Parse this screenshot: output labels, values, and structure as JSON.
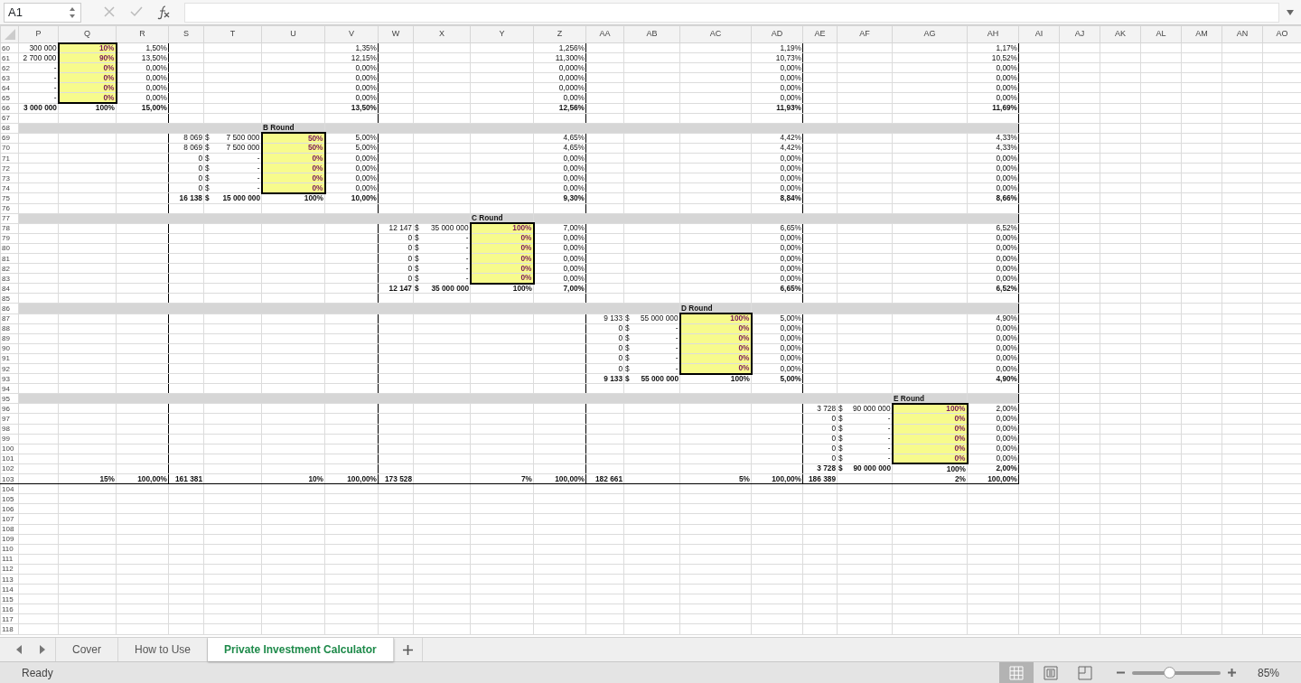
{
  "formula_bar": {
    "cell_ref": "A1"
  },
  "columns": [
    {
      "label": "P"
    },
    {
      "label": "Q"
    },
    {
      "label": "R"
    },
    {
      "label": "S"
    },
    {
      "label": "T"
    },
    {
      "label": "U"
    },
    {
      "label": "V"
    },
    {
      "label": "W"
    },
    {
      "label": "X"
    },
    {
      "label": "Y"
    },
    {
      "label": "Z"
    },
    {
      "label": "AA"
    },
    {
      "label": "AB"
    },
    {
      "label": "AC"
    },
    {
      "label": "AD"
    },
    {
      "label": "AE"
    },
    {
      "label": "AF"
    },
    {
      "label": "AG"
    },
    {
      "label": "AH"
    },
    {
      "label": "AI"
    },
    {
      "label": "AJ"
    },
    {
      "label": "AK"
    },
    {
      "label": "AL"
    },
    {
      "label": "AM"
    },
    {
      "label": "AN"
    },
    {
      "label": "AO"
    }
  ],
  "rows": [
    {
      "number": "60",
      "kind": "data",
      "cells": [
        {
          "text": "300 000"
        },
        {
          "text": "10%",
          "kind": "input"
        },
        {
          "text": "1,50%"
        },
        {},
        {},
        {},
        {
          "text": "1,35%"
        },
        {},
        {},
        {},
        {
          "text": "1,256%"
        },
        {},
        {},
        {},
        {
          "text": "1,19%"
        },
        {},
        {},
        {},
        {
          "text": "1,17%"
        }
      ]
    },
    {
      "number": "61",
      "kind": "data",
      "cells": [
        {
          "text": "2 700 000"
        },
        {
          "text": "90%",
          "kind": "input"
        },
        {
          "text": "13,50%"
        },
        {},
        {},
        {},
        {
          "text": "12,15%"
        },
        {},
        {},
        {},
        {
          "text": "11,300%"
        },
        {},
        {},
        {},
        {
          "text": "10,73%"
        },
        {},
        {},
        {},
        {
          "text": "10,52%"
        }
      ]
    },
    {
      "number": "62",
      "kind": "data",
      "cells": [
        {
          "text": "-"
        },
        {
          "text": "0%",
          "kind": "input"
        },
        {
          "text": "0,00%"
        },
        {},
        {},
        {},
        {
          "text": "0,00%"
        },
        {},
        {},
        {},
        {
          "text": "0,000%"
        },
        {},
        {},
        {},
        {
          "text": "0,00%"
        },
        {},
        {},
        {},
        {
          "text": "0,00%"
        }
      ]
    },
    {
      "number": "63",
      "kind": "data",
      "cells": [
        {
          "text": "-"
        },
        {
          "text": "0%",
          "kind": "input"
        },
        {
          "text": "0,00%"
        },
        {},
        {},
        {},
        {
          "text": "0,00%"
        },
        {},
        {},
        {},
        {
          "text": "0,000%"
        },
        {},
        {},
        {},
        {
          "text": "0,00%"
        },
        {},
        {},
        {},
        {
          "text": "0,00%"
        }
      ]
    },
    {
      "number": "64",
      "kind": "data",
      "cells": [
        {
          "text": "-"
        },
        {
          "text": "0%",
          "kind": "input"
        },
        {
          "text": "0,00%"
        },
        {},
        {},
        {},
        {
          "text": "0,00%"
        },
        {},
        {},
        {},
        {
          "text": "0,000%"
        },
        {},
        {},
        {},
        {
          "text": "0,00%"
        },
        {},
        {},
        {},
        {
          "text": "0,00%"
        }
      ]
    },
    {
      "number": "65",
      "kind": "data",
      "cells": [
        {
          "text": "-"
        },
        {
          "text": "0%",
          "kind": "input"
        },
        {
          "text": "0,00%"
        },
        {},
        {},
        {},
        {
          "text": "0,00%"
        },
        {},
        {},
        {},
        {
          "text": "0,00%"
        },
        {},
        {},
        {},
        {
          "text": "0,00%"
        },
        {},
        {},
        {},
        {
          "text": "0,00%"
        }
      ]
    },
    {
      "number": "66",
      "kind": "total",
      "cells": [
        {
          "text": "3 000 000"
        },
        {
          "text": "100%"
        },
        {
          "text": "15,00%"
        },
        {},
        {},
        {},
        {
          "text": "13,50%"
        },
        {},
        {},
        {},
        {
          "text": "12,56%"
        },
        {},
        {},
        {},
        {
          "text": "11,93%"
        },
        {},
        {},
        {},
        {
          "text": "11,69%"
        }
      ]
    },
    {
      "number": "67",
      "kind": "data",
      "cells": []
    },
    {
      "number": "68",
      "kind": "band",
      "cells": [
        {},
        {},
        {},
        {},
        {},
        {
          "text": "B Round"
        }
      ]
    },
    {
      "number": "69",
      "kind": "data",
      "cells": [
        {},
        {},
        {},
        {
          "text": "8 069"
        },
        {
          "currency": "$",
          "text": "7 500 000"
        },
        {
          "text": "50%",
          "kind": "input"
        },
        {
          "text": "5,00%"
        },
        {},
        {},
        {},
        {
          "text": "4,65%"
        },
        {},
        {},
        {},
        {
          "text": "4,42%"
        },
        {},
        {},
        {},
        {
          "text": "4,33%"
        }
      ]
    },
    {
      "number": "70",
      "kind": "data",
      "cells": [
        {},
        {},
        {},
        {
          "text": "8 069"
        },
        {
          "currency": "$",
          "text": "7 500 000"
        },
        {
          "text": "50%",
          "kind": "input"
        },
        {
          "text": "5,00%"
        },
        {},
        {},
        {},
        {
          "text": "4,65%"
        },
        {},
        {},
        {},
        {
          "text": "4,42%"
        },
        {},
        {},
        {},
        {
          "text": "4,33%"
        }
      ]
    },
    {
      "number": "71",
      "kind": "data",
      "cells": [
        {},
        {},
        {},
        {
          "text": "0"
        },
        {
          "currency": "$",
          "text": "-"
        },
        {
          "text": "0%",
          "kind": "input"
        },
        {
          "text": "0,00%"
        },
        {},
        {},
        {},
        {
          "text": "0,00%"
        },
        {},
        {},
        {},
        {
          "text": "0,00%"
        },
        {},
        {},
        {},
        {
          "text": "0,00%"
        }
      ]
    },
    {
      "number": "72",
      "kind": "data",
      "cells": [
        {},
        {},
        {},
        {
          "text": "0"
        },
        {
          "currency": "$",
          "text": "-"
        },
        {
          "text": "0%",
          "kind": "input"
        },
        {
          "text": "0,00%"
        },
        {},
        {},
        {},
        {
          "text": "0,00%"
        },
        {},
        {},
        {},
        {
          "text": "0,00%"
        },
        {},
        {},
        {},
        {
          "text": "0,00%"
        }
      ]
    },
    {
      "number": "73",
      "kind": "data",
      "cells": [
        {},
        {},
        {},
        {
          "text": "0"
        },
        {
          "currency": "$",
          "text": "-"
        },
        {
          "text": "0%",
          "kind": "input"
        },
        {
          "text": "0,00%"
        },
        {},
        {},
        {},
        {
          "text": "0,00%"
        },
        {},
        {},
        {},
        {
          "text": "0,00%"
        },
        {},
        {},
        {},
        {
          "text": "0,00%"
        }
      ]
    },
    {
      "number": "74",
      "kind": "data",
      "cells": [
        {},
        {},
        {},
        {
          "text": "0"
        },
        {
          "currency": "$",
          "text": "-"
        },
        {
          "text": "0%",
          "kind": "input"
        },
        {
          "text": "0,00%"
        },
        {},
        {},
        {},
        {
          "text": "0,00%"
        },
        {},
        {},
        {},
        {
          "text": "0,00%"
        },
        {},
        {},
        {},
        {
          "text": "0,00%"
        }
      ]
    },
    {
      "number": "75",
      "kind": "total",
      "cells": [
        {},
        {},
        {},
        {
          "text": "16 138"
        },
        {
          "currency": "$",
          "text": "15 000 000"
        },
        {
          "text": "100%"
        },
        {
          "text": "10,00%"
        },
        {},
        {},
        {},
        {
          "text": "9,30%"
        },
        {},
        {},
        {},
        {
          "text": "8,84%"
        },
        {},
        {},
        {},
        {
          "text": "8,66%"
        }
      ]
    },
    {
      "number": "76",
      "kind": "data",
      "cells": []
    },
    {
      "number": "77",
      "kind": "band",
      "cells": [
        {},
        {},
        {},
        {},
        {},
        {},
        {},
        {},
        {},
        {
          "text": "C Round"
        }
      ]
    },
    {
      "number": "78",
      "kind": "data",
      "cells": [
        {},
        {},
        {},
        {},
        {},
        {},
        {},
        {
          "text": "12 147"
        },
        {
          "currency": "$",
          "text": "35 000 000"
        },
        {
          "text": "100%",
          "kind": "input"
        },
        {
          "text": "7,00%"
        },
        {},
        {},
        {},
        {
          "text": "6,65%"
        },
        {},
        {},
        {},
        {
          "text": "6,52%"
        }
      ]
    },
    {
      "number": "79",
      "kind": "data",
      "cells": [
        {},
        {},
        {},
        {},
        {},
        {},
        {},
        {
          "text": "0"
        },
        {
          "currency": "$",
          "text": "-"
        },
        {
          "text": "0%",
          "kind": "input"
        },
        {
          "text": "0,00%"
        },
        {},
        {},
        {},
        {
          "text": "0,00%"
        },
        {},
        {},
        {},
        {
          "text": "0,00%"
        }
      ]
    },
    {
      "number": "80",
      "kind": "data",
      "cells": [
        {},
        {},
        {},
        {},
        {},
        {},
        {},
        {
          "text": "0"
        },
        {
          "currency": "$",
          "text": "-"
        },
        {
          "text": "0%",
          "kind": "input"
        },
        {
          "text": "0,00%"
        },
        {},
        {},
        {},
        {
          "text": "0,00%"
        },
        {},
        {},
        {},
        {
          "text": "0,00%"
        }
      ]
    },
    {
      "number": "81",
      "kind": "data",
      "cells": [
        {},
        {},
        {},
        {},
        {},
        {},
        {},
        {
          "text": "0"
        },
        {
          "currency": "$",
          "text": "-"
        },
        {
          "text": "0%",
          "kind": "input"
        },
        {
          "text": "0,00%"
        },
        {},
        {},
        {},
        {
          "text": "0,00%"
        },
        {},
        {},
        {},
        {
          "text": "0,00%"
        }
      ]
    },
    {
      "number": "82",
      "kind": "data",
      "cells": [
        {},
        {},
        {},
        {},
        {},
        {},
        {},
        {
          "text": "0"
        },
        {
          "currency": "$",
          "text": "-"
        },
        {
          "text": "0%",
          "kind": "input"
        },
        {
          "text": "0,00%"
        },
        {},
        {},
        {},
        {
          "text": "0,00%"
        },
        {},
        {},
        {},
        {
          "text": "0,00%"
        }
      ]
    },
    {
      "number": "83",
      "kind": "data",
      "cells": [
        {},
        {},
        {},
        {},
        {},
        {},
        {},
        {
          "text": "0"
        },
        {
          "currency": "$",
          "text": "-"
        },
        {
          "text": "0%",
          "kind": "input"
        },
        {
          "text": "0,00%"
        },
        {},
        {},
        {},
        {
          "text": "0,00%"
        },
        {},
        {},
        {},
        {
          "text": "0,00%"
        }
      ]
    },
    {
      "number": "84",
      "kind": "total",
      "cells": [
        {},
        {},
        {},
        {},
        {},
        {},
        {},
        {
          "text": "12 147"
        },
        {
          "currency": "$",
          "text": "35 000 000"
        },
        {
          "text": "100%"
        },
        {
          "text": "7,00%"
        },
        {},
        {},
        {},
        {
          "text": "6,65%"
        },
        {},
        {},
        {},
        {
          "text": "6,52%"
        }
      ]
    },
    {
      "number": "85",
      "kind": "data",
      "cells": []
    },
    {
      "number": "86",
      "kind": "band",
      "cells": [
        {},
        {},
        {},
        {},
        {},
        {},
        {},
        {},
        {},
        {},
        {},
        {},
        {},
        {
          "text": "D Round"
        }
      ]
    },
    {
      "number": "87",
      "kind": "data",
      "cells": [
        {},
        {},
        {},
        {},
        {},
        {},
        {},
        {},
        {},
        {},
        {},
        {
          "text": "9 133"
        },
        {
          "currency": "$",
          "text": "55 000 000"
        },
        {
          "text": "100%",
          "kind": "input"
        },
        {
          "text": "5,00%"
        },
        {},
        {},
        {},
        {
          "text": "4,90%"
        }
      ]
    },
    {
      "number": "88",
      "kind": "data",
      "cells": [
        {},
        {},
        {},
        {},
        {},
        {},
        {},
        {},
        {},
        {},
        {},
        {
          "text": "0"
        },
        {
          "currency": "$",
          "text": "-"
        },
        {
          "text": "0%",
          "kind": "input"
        },
        {
          "text": "0,00%"
        },
        {},
        {},
        {},
        {
          "text": "0,00%"
        }
      ]
    },
    {
      "number": "89",
      "kind": "data",
      "cells": [
        {},
        {},
        {},
        {},
        {},
        {},
        {},
        {},
        {},
        {},
        {},
        {
          "text": "0"
        },
        {
          "currency": "$",
          "text": "-"
        },
        {
          "text": "0%",
          "kind": "input"
        },
        {
          "text": "0,00%"
        },
        {},
        {},
        {},
        {
          "text": "0,00%"
        }
      ]
    },
    {
      "number": "90",
      "kind": "data",
      "cells": [
        {},
        {},
        {},
        {},
        {},
        {},
        {},
        {},
        {},
        {},
        {},
        {
          "text": "0"
        },
        {
          "currency": "$",
          "text": "-"
        },
        {
          "text": "0%",
          "kind": "input"
        },
        {
          "text": "0,00%"
        },
        {},
        {},
        {},
        {
          "text": "0,00%"
        }
      ]
    },
    {
      "number": "91",
      "kind": "data",
      "cells": [
        {},
        {},
        {},
        {},
        {},
        {},
        {},
        {},
        {},
        {},
        {},
        {
          "text": "0"
        },
        {
          "currency": "$",
          "text": "-"
        },
        {
          "text": "0%",
          "kind": "input"
        },
        {
          "text": "0,00%"
        },
        {},
        {},
        {},
        {
          "text": "0,00%"
        }
      ]
    },
    {
      "number": "92",
      "kind": "data",
      "cells": [
        {},
        {},
        {},
        {},
        {},
        {},
        {},
        {},
        {},
        {},
        {},
        {
          "text": "0"
        },
        {
          "currency": "$",
          "text": "-"
        },
        {
          "text": "0%",
          "kind": "input"
        },
        {
          "text": "0,00%"
        },
        {},
        {},
        {},
        {
          "text": "0,00%"
        }
      ]
    },
    {
      "number": "93",
      "kind": "total",
      "cells": [
        {},
        {},
        {},
        {},
        {},
        {},
        {},
        {},
        {},
        {},
        {},
        {
          "text": "9 133"
        },
        {
          "currency": "$",
          "text": "55 000 000"
        },
        {
          "text": "100%"
        },
        {
          "text": "5,00%"
        },
        {},
        {},
        {},
        {
          "text": "4,90%"
        }
      ]
    },
    {
      "number": "94",
      "kind": "data",
      "cells": []
    },
    {
      "number": "95",
      "kind": "band",
      "cells": [
        {},
        {},
        {},
        {},
        {},
        {},
        {},
        {},
        {},
        {},
        {},
        {},
        {},
        {},
        {},
        {},
        {},
        {
          "text": "E Round"
        }
      ]
    },
    {
      "number": "96",
      "kind": "data",
      "cells": [
        {},
        {},
        {},
        {},
        {},
        {},
        {},
        {},
        {},
        {},
        {},
        {},
        {},
        {},
        {},
        {
          "text": "3 728"
        },
        {
          "currency": "$",
          "text": "90 000 000"
        },
        {
          "text": "100%",
          "kind": "input"
        },
        {
          "text": "2,00%"
        }
      ]
    },
    {
      "number": "97",
      "kind": "data",
      "cells": [
        {},
        {},
        {},
        {},
        {},
        {},
        {},
        {},
        {},
        {},
        {},
        {},
        {},
        {},
        {},
        {
          "text": "0"
        },
        {
          "currency": "$",
          "text": "-"
        },
        {
          "text": "0%",
          "kind": "input"
        },
        {
          "text": "0,00%"
        }
      ]
    },
    {
      "number": "98",
      "kind": "data",
      "cells": [
        {},
        {},
        {},
        {},
        {},
        {},
        {},
        {},
        {},
        {},
        {},
        {},
        {},
        {},
        {},
        {
          "text": "0"
        },
        {
          "currency": "$",
          "text": "-"
        },
        {
          "text": "0%",
          "kind": "input"
        },
        {
          "text": "0,00%"
        }
      ]
    },
    {
      "number": "99",
      "kind": "data",
      "cells": [
        {},
        {},
        {},
        {},
        {},
        {},
        {},
        {},
        {},
        {},
        {},
        {},
        {},
        {},
        {},
        {
          "text": "0"
        },
        {
          "currency": "$",
          "text": "-"
        },
        {
          "text": "0%",
          "kind": "input"
        },
        {
          "text": "0,00%"
        }
      ]
    },
    {
      "number": "100",
      "kind": "data",
      "cells": [
        {},
        {},
        {},
        {},
        {},
        {},
        {},
        {},
        {},
        {},
        {},
        {},
        {},
        {},
        {},
        {
          "text": "0"
        },
        {
          "currency": "$",
          "text": "-"
        },
        {
          "text": "0%",
          "kind": "input"
        },
        {
          "text": "0,00%"
        }
      ]
    },
    {
      "number": "101",
      "kind": "data",
      "cells": [
        {},
        {},
        {},
        {},
        {},
        {},
        {},
        {},
        {},
        {},
        {},
        {},
        {},
        {},
        {},
        {
          "text": "0"
        },
        {
          "currency": "$",
          "text": "-"
        },
        {
          "text": "0%",
          "kind": "input"
        },
        {
          "text": "0,00%"
        }
      ]
    },
    {
      "number": "102",
      "kind": "total",
      "cells": [
        {},
        {},
        {},
        {},
        {},
        {},
        {},
        {},
        {},
        {},
        {},
        {},
        {},
        {},
        {},
        {
          "text": "3 728"
        },
        {
          "currency": "$",
          "text": "90 000 000"
        },
        {
          "text": "100%"
        },
        {
          "text": "2,00%"
        }
      ]
    },
    {
      "number": "103",
      "kind": "grand_total",
      "cells": [
        {},
        {
          "text": "15%"
        },
        {
          "text": "100,00%"
        },
        {
          "text": "161 381"
        },
        {},
        {
          "text": "10%"
        },
        {
          "text": "100,00%"
        },
        {
          "text": "173 528"
        },
        {},
        {
          "text": "7%"
        },
        {
          "text": "100,00%"
        },
        {
          "text": "182 661"
        },
        {},
        {
          "text": "5%"
        },
        {
          "text": "100,00%"
        },
        {
          "text": "186 389"
        },
        {},
        {
          "text": "2%"
        },
        {
          "text": "100,00%"
        }
      ]
    },
    {
      "number": "104",
      "kind": "data",
      "cells": []
    },
    {
      "number": "105",
      "kind": "data",
      "cells": []
    },
    {
      "number": "106",
      "kind": "data",
      "cells": []
    },
    {
      "number": "107",
      "kind": "data",
      "cells": []
    },
    {
      "number": "108",
      "kind": "data",
      "cells": []
    },
    {
      "number": "109",
      "kind": "data",
      "cells": []
    },
    {
      "number": "110",
      "kind": "data",
      "cells": []
    },
    {
      "number": "111",
      "kind": "data",
      "cells": []
    },
    {
      "number": "112",
      "kind": "data",
      "cells": []
    },
    {
      "number": "113",
      "kind": "data",
      "cells": []
    },
    {
      "number": "114",
      "kind": "data",
      "cells": []
    },
    {
      "number": "115",
      "kind": "data",
      "cells": []
    },
    {
      "number": "116",
      "kind": "data",
      "cells": []
    },
    {
      "number": "117",
      "kind": "data",
      "cells": []
    },
    {
      "number": "118",
      "kind": "data",
      "cells": []
    }
  ],
  "sheet_tabs": [
    {
      "label": "Cover",
      "selected": false
    },
    {
      "label": "How to Use",
      "selected": false
    },
    {
      "label": "Private Investment Calculator",
      "selected": true
    }
  ],
  "status_bar": {
    "status": "Ready",
    "views": [
      {
        "kind": "normal",
        "selected": true
      },
      {
        "kind": "page_layout",
        "selected": false
      },
      {
        "kind": "page_break",
        "selected": false
      }
    ],
    "zoom": {
      "level": 0.42,
      "reading": "85%"
    }
  }
}
